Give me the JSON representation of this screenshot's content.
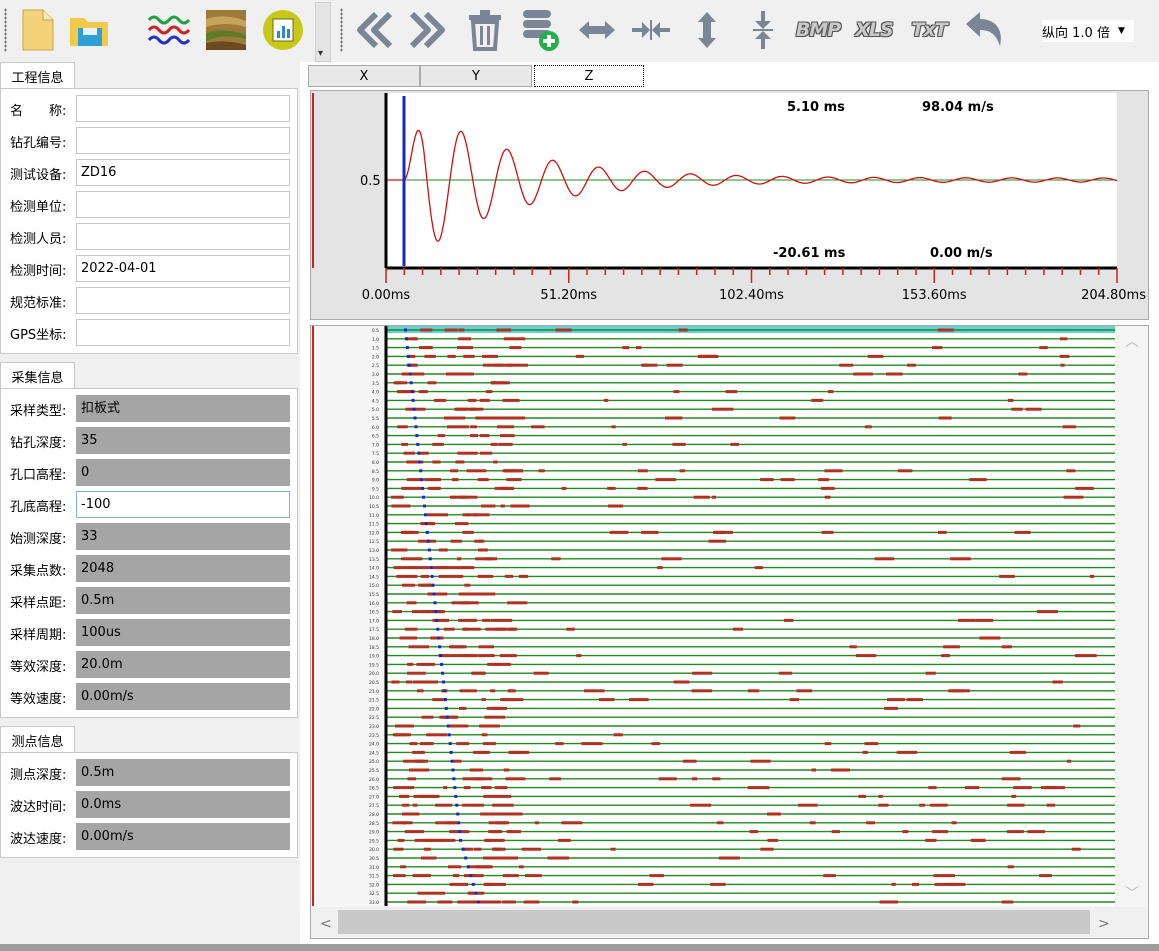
{
  "toolbar": {
    "zoom_value": "纵向 1.0 倍",
    "buttons": [
      {
        "name": "new-file-icon"
      },
      {
        "name": "open-folder-icon"
      },
      {
        "name": "waveform-icon"
      },
      {
        "name": "strata-image-icon"
      },
      {
        "name": "report-icon"
      },
      {
        "name": "previous-icon"
      },
      {
        "name": "next-icon"
      },
      {
        "name": "delete-icon"
      },
      {
        "name": "add-record-icon"
      },
      {
        "name": "stretch-horizontal-icon"
      },
      {
        "name": "compress-horizontal-icon"
      },
      {
        "name": "stretch-vertical-icon"
      },
      {
        "name": "compress-vertical-icon"
      },
      {
        "name": "export-bmp-icon"
      },
      {
        "name": "export-xls-icon"
      },
      {
        "name": "export-txt-icon"
      },
      {
        "name": "undo-icon"
      }
    ],
    "bmp_label": "BMP",
    "xls_label": "XLS",
    "txt_label": "TxT"
  },
  "project": {
    "tab": "工程信息",
    "fields": [
      {
        "label": "名　　称:",
        "value": ""
      },
      {
        "label": "钻孔编号:",
        "value": ""
      },
      {
        "label": "测试设备:",
        "value": "ZD16"
      },
      {
        "label": "检测单位:",
        "value": ""
      },
      {
        "label": "检测人员:",
        "value": ""
      },
      {
        "label": "检测时间:",
        "value": "2022-04-01"
      },
      {
        "label": "规范标准:",
        "value": ""
      },
      {
        "label": "GPS坐标:",
        "value": ""
      }
    ]
  },
  "acquisition": {
    "tab": "采集信息",
    "fields": [
      {
        "label": "采样类型:",
        "value": "扣板式"
      },
      {
        "label": "钻孔深度:",
        "value": "35"
      },
      {
        "label": "孔口高程:",
        "value": "0"
      },
      {
        "label": "孔底高程:",
        "value": "-100"
      },
      {
        "label": "始测深度:",
        "value": "33"
      },
      {
        "label": "采集点数:",
        "value": "2048"
      },
      {
        "label": "采样点距:",
        "value": "0.5m"
      },
      {
        "label": "采样周期:",
        "value": "100us"
      },
      {
        "label": "等效深度:",
        "value": "20.0m"
      },
      {
        "label": "等效速度:",
        "value": "0.00m/s"
      }
    ]
  },
  "point": {
    "tab": "测点信息",
    "fields": [
      {
        "label": "测点深度:",
        "value": "0.5m"
      },
      {
        "label": "波达时间:",
        "value": "0.0ms"
      },
      {
        "label": "波达速度:",
        "value": "0.00m/s"
      }
    ]
  },
  "axis_tabs": [
    "X",
    "Y",
    "Z"
  ],
  "waveform": {
    "top_time": "5.10 ms",
    "top_velocity": "98.04 m/s",
    "bottom_time": "-20.61 ms",
    "bottom_velocity": "0.00 m/s",
    "y_label": "0.5",
    "x_ticks": [
      "0.00ms",
      "51.20ms",
      "102.40ms",
      "153.60ms",
      "204.80ms"
    ]
  },
  "gather": {
    "depths": [
      "0.5",
      "1.0",
      "1.5",
      "2.0",
      "2.5",
      "3.0",
      "3.5",
      "4.0",
      "4.5",
      "5.0",
      "5.5",
      "6.0",
      "6.5",
      "7.0",
      "7.5",
      "8.0",
      "8.5",
      "9.0",
      "9.5",
      "10.0",
      "10.5",
      "11.0",
      "11.5",
      "12.0",
      "12.5",
      "13.0",
      "13.5",
      "14.0",
      "14.5",
      "15.0",
      "15.5",
      "16.0",
      "16.5",
      "17.0",
      "17.5",
      "18.0",
      "18.5",
      "19.0",
      "19.5",
      "20.0",
      "20.5",
      "21.0",
      "21.5",
      "22.0",
      "22.5",
      "23.0",
      "23.5",
      "24.0",
      "24.5",
      "25.0",
      "25.5",
      "26.0",
      "26.5",
      "27.0",
      "27.5",
      "28.0",
      "28.5",
      "29.0",
      "29.5",
      "30.0",
      "30.5",
      "31.0",
      "31.5",
      "32.0",
      "32.5",
      "33.0"
    ],
    "scroll_left": "<",
    "scroll_right": ">"
  },
  "colors": {
    "trace": "#1e8c1e",
    "trace_event": "#b0321e",
    "pick_marker": "#1428c8",
    "waveform_line": "#d01010",
    "selected_row": "#66cfd8"
  }
}
